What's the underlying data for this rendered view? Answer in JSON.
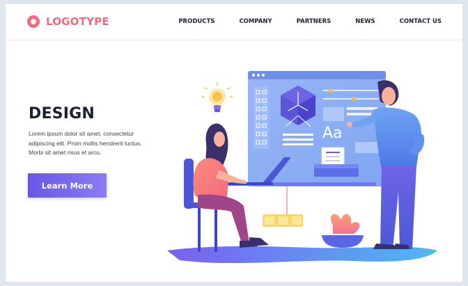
{
  "header": {
    "logo_text": "LOGOTYPE",
    "nav": [
      "PRODUCTS",
      "COMPANY",
      "PARTNERS",
      "NEWS",
      "CONTACT US"
    ]
  },
  "hero": {
    "title": "DESIGN",
    "body_lines": [
      "Lorem ipsum dolor sit amet, consectetur",
      "adipiscing elit. Proin mollis hendrerit luctus.",
      "Morbi sit amet risus et arcu."
    ],
    "cta_label": "Learn More"
  },
  "illustration": {
    "type_specimen": "Aa",
    "icons": [
      "lightbulb-icon",
      "cube-icon",
      "printer-icon",
      "plant-icon",
      "laptop-icon"
    ]
  },
  "colors": {
    "brand": "#f06a7c",
    "accent": "#6a56e6",
    "screen": "#8fb0f3",
    "text": "#1d2230"
  }
}
